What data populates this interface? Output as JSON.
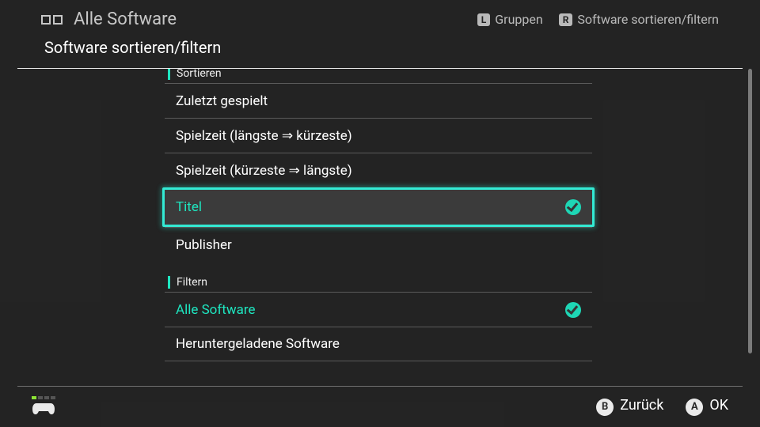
{
  "bg": {
    "title": "Alle Software",
    "hints": {
      "groups_key": "L",
      "groups_label": "Gruppen",
      "sort_key": "R",
      "sort_label": "Software sortieren/filtern"
    }
  },
  "panel": {
    "title": "Software sortieren/filtern",
    "sort_header": "Sortieren",
    "filter_header": "Filtern",
    "sort_options": {
      "recent": "Zuletzt gespielt",
      "longest": "Spielzeit (längste ⇒ kürzeste)",
      "shortest": "Spielzeit (kürzeste ⇒ längste)",
      "title": "Titel",
      "publisher": "Publisher"
    },
    "filter_options": {
      "all": "Alle Software",
      "downloaded": "Heruntergeladene Software"
    }
  },
  "footer": {
    "back_label": "Zurück",
    "ok_label": "OK",
    "back_key": "B",
    "ok_key": "A"
  }
}
